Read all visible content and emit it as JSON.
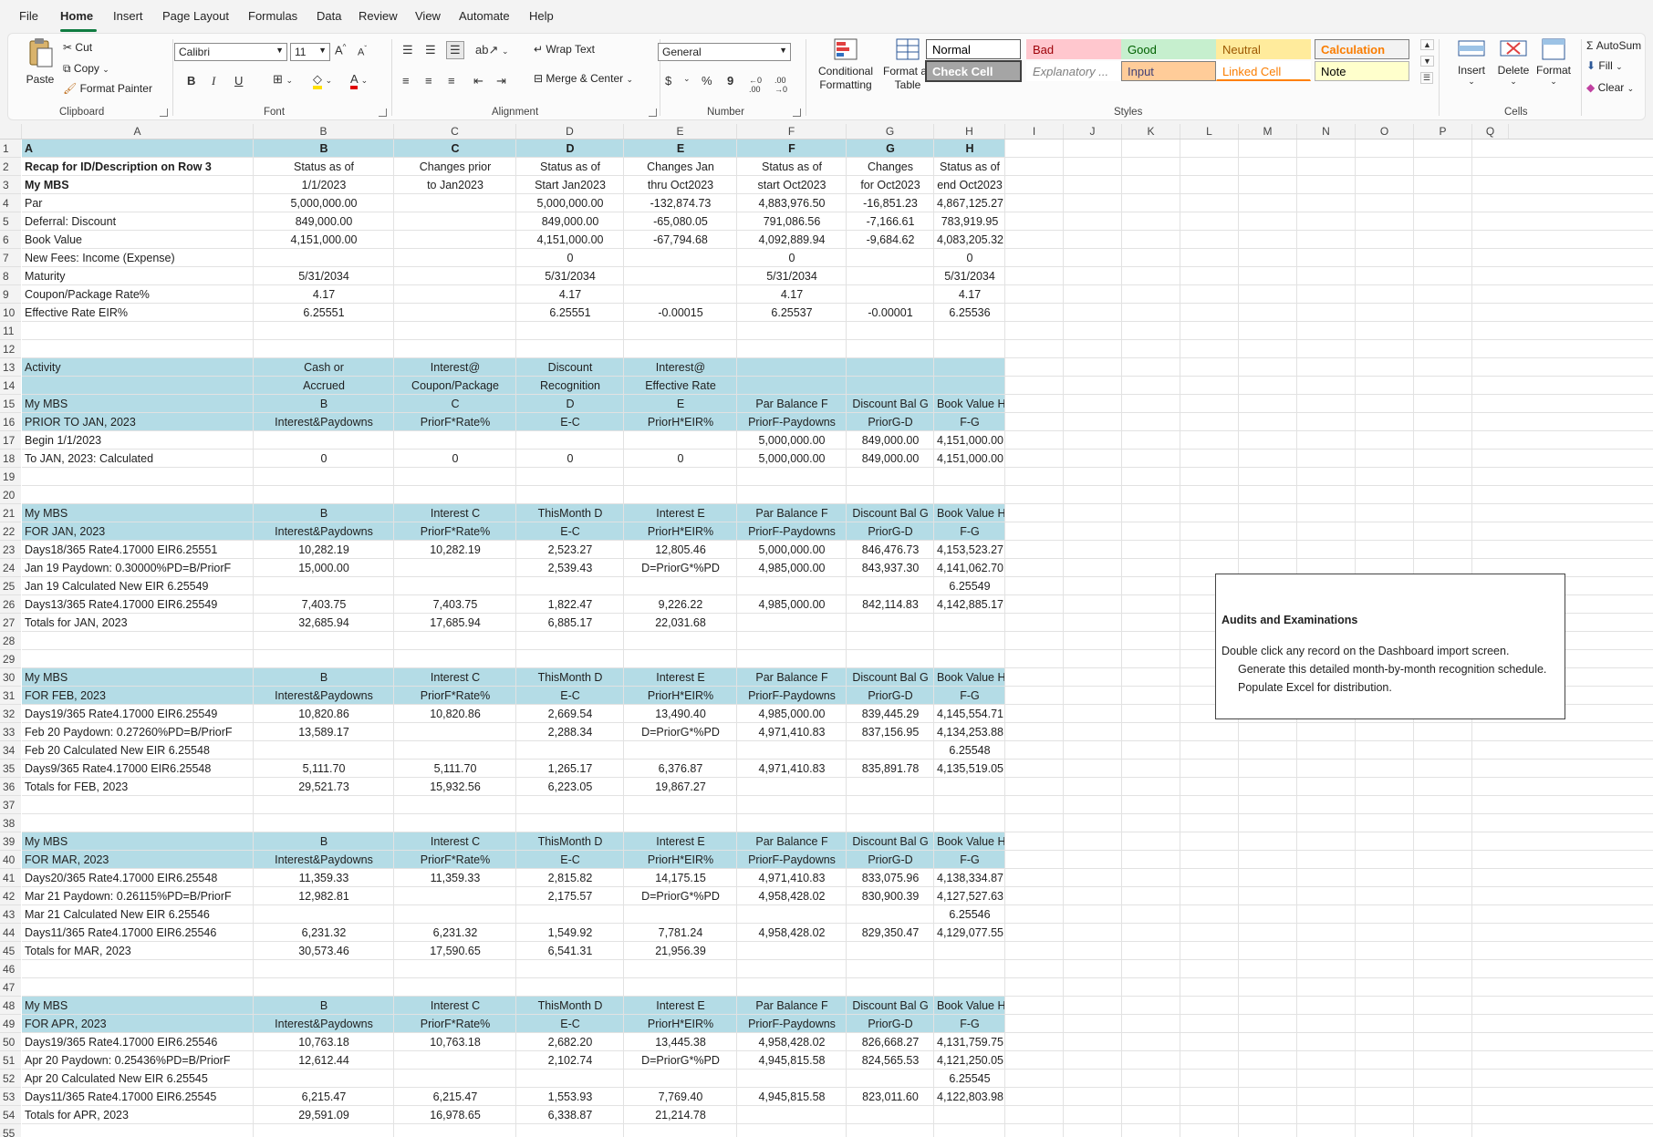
{
  "menu": {
    "items": [
      "File",
      "Home",
      "Insert",
      "Page Layout",
      "Formulas",
      "Data",
      "Review",
      "View",
      "Automate",
      "Help"
    ],
    "active": "Home"
  },
  "ribbon": {
    "clipboard": {
      "paste": "Paste",
      "cut": "Cut",
      "copy": "Copy",
      "format_painter": "Format Painter",
      "label": "Clipboard"
    },
    "font": {
      "name": "Calibri",
      "size": "11",
      "bold": "B",
      "italic": "I",
      "underline": "U",
      "label": "Font"
    },
    "alignment": {
      "wrap": "Wrap Text",
      "merge": "Merge & Center",
      "label": "Alignment"
    },
    "number": {
      "format": "General",
      "currency": "$",
      "percent": "%",
      "comma": "9",
      "inc": ".00",
      "label": "Number"
    },
    "styles": {
      "conditional": "Conditional Formatting",
      "format_table": "Format as Table",
      "cells": [
        {
          "name": "Normal",
          "bg": "#ffffff",
          "fg": "#000000",
          "border": "#5a5a5a"
        },
        {
          "name": "Bad",
          "bg": "#ffc7ce",
          "fg": "#9c0006",
          "border": "#ffc7ce"
        },
        {
          "name": "Good",
          "bg": "#c6efce",
          "fg": "#006100",
          "border": "#c6efce"
        },
        {
          "name": "Neutral",
          "bg": "#ffeb9c",
          "fg": "#9c5700",
          "border": "#ffeb9c"
        },
        {
          "name": "Calculation",
          "bg": "#f2f2f2",
          "fg": "#fa7d00",
          "border": "#7f7f7f"
        },
        {
          "name": "Check Cell",
          "bg": "#a5a5a5",
          "fg": "#ffffff",
          "border": "#3f3f3f"
        },
        {
          "name": "Explanatory ...",
          "bg": "#ffffff",
          "fg": "#7f7f7f",
          "border": "#ffffff"
        },
        {
          "name": "Input",
          "bg": "#ffcc99",
          "fg": "#3f3f76",
          "border": "#7f7f7f"
        },
        {
          "name": "Linked Cell",
          "bg": "#ffffff",
          "fg": "#fa7d00",
          "border": "#ffffff"
        },
        {
          "name": "Note",
          "bg": "#ffffcc",
          "fg": "#000000",
          "border": "#b2b2b2"
        }
      ],
      "label": "Styles"
    },
    "cells": {
      "insert": "Insert",
      "delete": "Delete",
      "format": "Format",
      "label": "Cells"
    },
    "editing": {
      "autosum": "AutoSum",
      "fill": "Fill",
      "clear": "Clear"
    }
  },
  "columns": [
    "A",
    "B",
    "C",
    "D",
    "E",
    "F",
    "G",
    "H",
    "I",
    "J",
    "K",
    "L",
    "M",
    "N",
    "O",
    "P",
    "Q"
  ],
  "rows": [
    {
      "n": 1,
      "hdr": true,
      "cells": [
        "A",
        "B",
        "C",
        "D",
        "E",
        "F",
        "G",
        "H"
      ]
    },
    {
      "n": 2,
      "cells": [
        "Recap for ID/Description on Row 3",
        "Status as of",
        "Changes prior",
        "Status as of",
        "Changes Jan",
        "Status as of",
        "Changes",
        "Status as of"
      ],
      "bold": true
    },
    {
      "n": 3,
      "cells": [
        "My MBS",
        "1/1/2023",
        "to Jan2023",
        "Start Jan2023",
        "thru Oct2023",
        "start Oct2023",
        "for Oct2023",
        "end Oct2023"
      ],
      "bold": true
    },
    {
      "n": 4,
      "cells": [
        "Par",
        "5,000,000.00",
        "",
        "5,000,000.00",
        "-132,874.73",
        "4,883,976.50",
        "-16,851.23",
        "4,867,125.27"
      ]
    },
    {
      "n": 5,
      "cells": [
        "Deferral: Discount",
        "849,000.00",
        "",
        "849,000.00",
        "-65,080.05",
        "791,086.56",
        "-7,166.61",
        "783,919.95"
      ]
    },
    {
      "n": 6,
      "cells": [
        "Book Value",
        "4,151,000.00",
        "",
        "4,151,000.00",
        "-67,794.68",
        "4,092,889.94",
        "-9,684.62",
        "4,083,205.32"
      ]
    },
    {
      "n": 7,
      "cells": [
        "New Fees: Income (Expense)",
        "",
        "",
        "0",
        "",
        "0",
        "",
        "0"
      ]
    },
    {
      "n": 8,
      "cells": [
        "Maturity",
        "5/31/2034",
        "",
        "5/31/2034",
        "",
        "5/31/2034",
        "",
        "5/31/2034"
      ]
    },
    {
      "n": 9,
      "cells": [
        "Coupon/Package Rate%",
        "4.17",
        "",
        "4.17",
        "",
        "4.17",
        "",
        "4.17"
      ]
    },
    {
      "n": 10,
      "cells": [
        "Effective Rate EIR%",
        "6.25551",
        "",
        "6.25551",
        "-0.00015",
        "6.25537",
        "-0.00001",
        "6.25536"
      ]
    },
    {
      "n": 11,
      "cells": [
        "",
        "",
        "",
        "",
        "",
        "",
        "",
        ""
      ]
    },
    {
      "n": 12,
      "cells": [
        "",
        "",
        "",
        "",
        "",
        "",
        "",
        ""
      ]
    },
    {
      "n": 13,
      "hdr": true,
      "cells": [
        "Activity",
        "Cash or",
        "Interest@",
        "Discount",
        "Interest@",
        "",
        "",
        ""
      ]
    },
    {
      "n": 14,
      "hdr": true,
      "cells": [
        "",
        "Accrued",
        "Coupon/Package",
        "Recognition",
        "Effective Rate",
        "",
        "",
        ""
      ]
    },
    {
      "n": 15,
      "hdr": true,
      "cells": [
        "My MBS",
        "B",
        "C",
        "D",
        "E",
        "Par Balance F",
        "Discount Bal G",
        "Book Value H"
      ]
    },
    {
      "n": 16,
      "hdr": true,
      "cells": [
        "PRIOR TO JAN, 2023",
        "Interest&Paydowns",
        "PriorF*Rate%",
        "E-C",
        "PriorH*EIR%",
        "PriorF-Paydowns",
        "PriorG-D",
        "F-G"
      ]
    },
    {
      "n": 17,
      "cells": [
        "Begin 1/1/2023",
        "",
        "",
        "",
        "",
        "5,000,000.00",
        "849,000.00",
        "4,151,000.00"
      ]
    },
    {
      "n": 18,
      "cells": [
        "To JAN, 2023: Calculated",
        "0",
        "0",
        "0",
        "0",
        "5,000,000.00",
        "849,000.00",
        "4,151,000.00"
      ]
    },
    {
      "n": 19,
      "cells": [
        "",
        "",
        "",
        "",
        "",
        "",
        "",
        ""
      ]
    },
    {
      "n": 20,
      "cells": [
        "",
        "",
        "",
        "",
        "",
        "",
        "",
        ""
      ]
    },
    {
      "n": 21,
      "hdr": true,
      "cells": [
        "My MBS",
        "B",
        "Interest C",
        "ThisMonth D",
        "Interest E",
        "Par Balance F",
        "Discount Bal G",
        "Book Value H"
      ]
    },
    {
      "n": 22,
      "hdr": true,
      "cells": [
        "FOR JAN, 2023",
        "Interest&Paydowns",
        "PriorF*Rate%",
        "E-C",
        "PriorH*EIR%",
        "PriorF-Paydowns",
        "PriorG-D",
        "F-G"
      ]
    },
    {
      "n": 23,
      "cells": [
        "Days18/365 Rate4.17000 EIR6.25551",
        "10,282.19",
        "10,282.19",
        "2,523.27",
        "12,805.46",
        "5,000,000.00",
        "846,476.73",
        "4,153,523.27"
      ]
    },
    {
      "n": 24,
      "cells": [
        "Jan 19 Paydown: 0.30000%PD=B/PriorF",
        "15,000.00",
        "",
        "2,539.43",
        "D=PriorG*%PD",
        "4,985,000.00",
        "843,937.30",
        "4,141,062.70"
      ]
    },
    {
      "n": 25,
      "cells": [
        "Jan 19 Calculated New EIR 6.25549",
        "",
        "",
        "",
        "",
        "",
        "",
        "6.25549"
      ]
    },
    {
      "n": 26,
      "cells": [
        "Days13/365 Rate4.17000 EIR6.25549",
        "7,403.75",
        "7,403.75",
        "1,822.47",
        "9,226.22",
        "4,985,000.00",
        "842,114.83",
        "4,142,885.17"
      ]
    },
    {
      "n": 27,
      "cells": [
        "Totals for JAN, 2023",
        "32,685.94",
        "17,685.94",
        "6,885.17",
        "22,031.68",
        "",
        "",
        ""
      ]
    },
    {
      "n": 28,
      "cells": [
        "",
        "",
        "",
        "",
        "",
        "",
        "",
        ""
      ]
    },
    {
      "n": 29,
      "cells": [
        "",
        "",
        "",
        "",
        "",
        "",
        "",
        ""
      ]
    },
    {
      "n": 30,
      "hdr": true,
      "cells": [
        "My MBS",
        "B",
        "Interest C",
        "ThisMonth D",
        "Interest E",
        "Par Balance F",
        "Discount Bal G",
        "Book Value H"
      ]
    },
    {
      "n": 31,
      "hdr": true,
      "cells": [
        "FOR FEB, 2023",
        "Interest&Paydowns",
        "PriorF*Rate%",
        "E-C",
        "PriorH*EIR%",
        "PriorF-Paydowns",
        "PriorG-D",
        "F-G"
      ]
    },
    {
      "n": 32,
      "cells": [
        "Days19/365 Rate4.17000 EIR6.25549",
        "10,820.86",
        "10,820.86",
        "2,669.54",
        "13,490.40",
        "4,985,000.00",
        "839,445.29",
        "4,145,554.71"
      ]
    },
    {
      "n": 33,
      "cells": [
        "Feb 20 Paydown: 0.27260%PD=B/PriorF",
        "13,589.17",
        "",
        "2,288.34",
        "D=PriorG*%PD",
        "4,971,410.83",
        "837,156.95",
        "4,134,253.88"
      ]
    },
    {
      "n": 34,
      "cells": [
        "Feb 20 Calculated New EIR 6.25548",
        "",
        "",
        "",
        "",
        "",
        "",
        "6.25548"
      ]
    },
    {
      "n": 35,
      "cells": [
        "Days9/365 Rate4.17000 EIR6.25548",
        "5,111.70",
        "5,111.70",
        "1,265.17",
        "6,376.87",
        "4,971,410.83",
        "835,891.78",
        "4,135,519.05"
      ]
    },
    {
      "n": 36,
      "cells": [
        "Totals for FEB, 2023",
        "29,521.73",
        "15,932.56",
        "6,223.05",
        "19,867.27",
        "",
        "",
        ""
      ]
    },
    {
      "n": 37,
      "cells": [
        "",
        "",
        "",
        "",
        "",
        "",
        "",
        ""
      ]
    },
    {
      "n": 38,
      "cells": [
        "",
        "",
        "",
        "",
        "",
        "",
        "",
        ""
      ]
    },
    {
      "n": 39,
      "hdr": true,
      "cells": [
        "My MBS",
        "B",
        "Interest C",
        "ThisMonth D",
        "Interest E",
        "Par Balance F",
        "Discount Bal G",
        "Book Value H"
      ]
    },
    {
      "n": 40,
      "hdr": true,
      "cells": [
        "FOR MAR, 2023",
        "Interest&Paydowns",
        "PriorF*Rate%",
        "E-C",
        "PriorH*EIR%",
        "PriorF-Paydowns",
        "PriorG-D",
        "F-G"
      ]
    },
    {
      "n": 41,
      "cells": [
        "Days20/365 Rate4.17000 EIR6.25548",
        "11,359.33",
        "11,359.33",
        "2,815.82",
        "14,175.15",
        "4,971,410.83",
        "833,075.96",
        "4,138,334.87"
      ]
    },
    {
      "n": 42,
      "cells": [
        "Mar 21 Paydown: 0.26115%PD=B/PriorF",
        "12,982.81",
        "",
        "2,175.57",
        "D=PriorG*%PD",
        "4,958,428.02",
        "830,900.39",
        "4,127,527.63"
      ]
    },
    {
      "n": 43,
      "cells": [
        "Mar 21 Calculated New EIR 6.25546",
        "",
        "",
        "",
        "",
        "",
        "",
        "6.25546"
      ]
    },
    {
      "n": 44,
      "cells": [
        "Days11/365 Rate4.17000 EIR6.25546",
        "6,231.32",
        "6,231.32",
        "1,549.92",
        "7,781.24",
        "4,958,428.02",
        "829,350.47",
        "4,129,077.55"
      ]
    },
    {
      "n": 45,
      "cells": [
        "Totals for MAR, 2023",
        "30,573.46",
        "17,590.65",
        "6,541.31",
        "21,956.39",
        "",
        "",
        ""
      ]
    },
    {
      "n": 46,
      "cells": [
        "",
        "",
        "",
        "",
        "",
        "",
        "",
        ""
      ]
    },
    {
      "n": 47,
      "cells": [
        "",
        "",
        "",
        "",
        "",
        "",
        "",
        ""
      ]
    },
    {
      "n": 48,
      "hdr": true,
      "cells": [
        "My MBS",
        "B",
        "Interest C",
        "ThisMonth D",
        "Interest E",
        "Par Balance F",
        "Discount Bal G",
        "Book Value H"
      ]
    },
    {
      "n": 49,
      "hdr": true,
      "cells": [
        "FOR APR, 2023",
        "Interest&Paydowns",
        "PriorF*Rate%",
        "E-C",
        "PriorH*EIR%",
        "PriorF-Paydowns",
        "PriorG-D",
        "F-G"
      ]
    },
    {
      "n": 50,
      "cells": [
        "Days19/365 Rate4.17000 EIR6.25546",
        "10,763.18",
        "10,763.18",
        "2,682.20",
        "13,445.38",
        "4,958,428.02",
        "826,668.27",
        "4,131,759.75"
      ]
    },
    {
      "n": 51,
      "cells": [
        "Apr 20 Paydown: 0.25436%PD=B/PriorF",
        "12,612.44",
        "",
        "2,102.74",
        "D=PriorG*%PD",
        "4,945,815.58",
        "824,565.53",
        "4,121,250.05"
      ]
    },
    {
      "n": 52,
      "cells": [
        "Apr 20 Calculated New EIR 6.25545",
        "",
        "",
        "",
        "",
        "",
        "",
        "6.25545"
      ]
    },
    {
      "n": 53,
      "cells": [
        "Days11/365 Rate4.17000 EIR6.25545",
        "6,215.47",
        "6,215.47",
        "1,553.93",
        "7,769.40",
        "4,945,815.58",
        "823,011.60",
        "4,122,803.98"
      ]
    },
    {
      "n": 54,
      "cells": [
        "Totals for APR, 2023",
        "29,591.09",
        "16,978.65",
        "6,338.87",
        "21,214.78",
        "",
        "",
        ""
      ]
    },
    {
      "n": 55,
      "cells": [
        "",
        "",
        "",
        "",
        "",
        "",
        "",
        ""
      ]
    }
  ],
  "note": {
    "title": "Audits and Examinations",
    "lines": [
      "Double click any record on the Dashboard import screen.",
      "Generate this detailed month-by-month recognition schedule.",
      "Populate Excel for distribution."
    ]
  }
}
